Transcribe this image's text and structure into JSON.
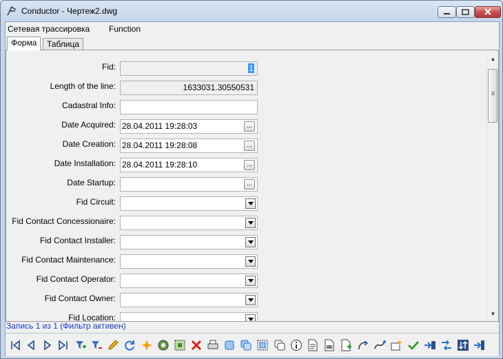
{
  "window": {
    "title": "Conductor - Чертеж2.dwg"
  },
  "menu": {
    "items": [
      "Сетевая трассировка",
      "Function"
    ]
  },
  "tabs": [
    "Форма",
    "Таблица"
  ],
  "form": {
    "fid": {
      "label": "Fid:",
      "value": "1"
    },
    "length": {
      "label": "Length of the line:",
      "value": "1633031.30550531"
    },
    "cadastral": {
      "label": "Cadastral Info:",
      "value": ""
    },
    "date_acquired": {
      "label": "Date Acquired:",
      "value": "28.04.2011 19:28:03"
    },
    "date_creation": {
      "label": "Date Creation:",
      "value": "28.04.2011 19:28:08"
    },
    "date_installation": {
      "label": "Date Installation:",
      "value": "28.04.2011 19:28:10"
    },
    "date_startup": {
      "label": "Date Startup:",
      "value": ""
    },
    "fid_circuit": {
      "label": "Fid Circuit:",
      "value": ""
    },
    "fid_concessionaire": {
      "label": "Fid Contact Concessionaire:",
      "value": ""
    },
    "fid_installer": {
      "label": "Fid Contact Installer:",
      "value": ""
    },
    "fid_maintenance": {
      "label": "Fid Contact Maintenance:",
      "value": ""
    },
    "fid_operator": {
      "label": "Fid Contact Operator:",
      "value": ""
    },
    "fid_owner": {
      "label": "Fid Contact Owner:",
      "value": ""
    },
    "fid_location": {
      "label": "Fid Location:",
      "value": ""
    },
    "browse_label": "..."
  },
  "status": {
    "text": "Запись 1 из 1 (Фильтр активен)"
  },
  "toolbar": {
    "icons": [
      "first-record-icon",
      "prev-record-icon",
      "next-record-icon",
      "last-record-icon",
      "add-filter-icon",
      "remove-filter-icon",
      "edit-pencil-icon",
      "refresh-icon",
      "new-star-icon",
      "zoom-globe-icon",
      "select-icon",
      "delete-x-icon",
      "print-icon",
      "copy-icon",
      "paste-icon",
      "select-frame-icon",
      "duplicate-icon",
      "info-icon",
      "document-icon",
      "report-icon",
      "calc-icon",
      "link-icon",
      "trace-icon",
      "new-record-icon",
      "check-icon",
      "export-icon",
      "network-icon",
      "sort-icon",
      "exit-icon"
    ]
  },
  "colors": {
    "accent": "#3399ff",
    "status_text": "#1a3ccc",
    "delete": "#d9201a"
  }
}
